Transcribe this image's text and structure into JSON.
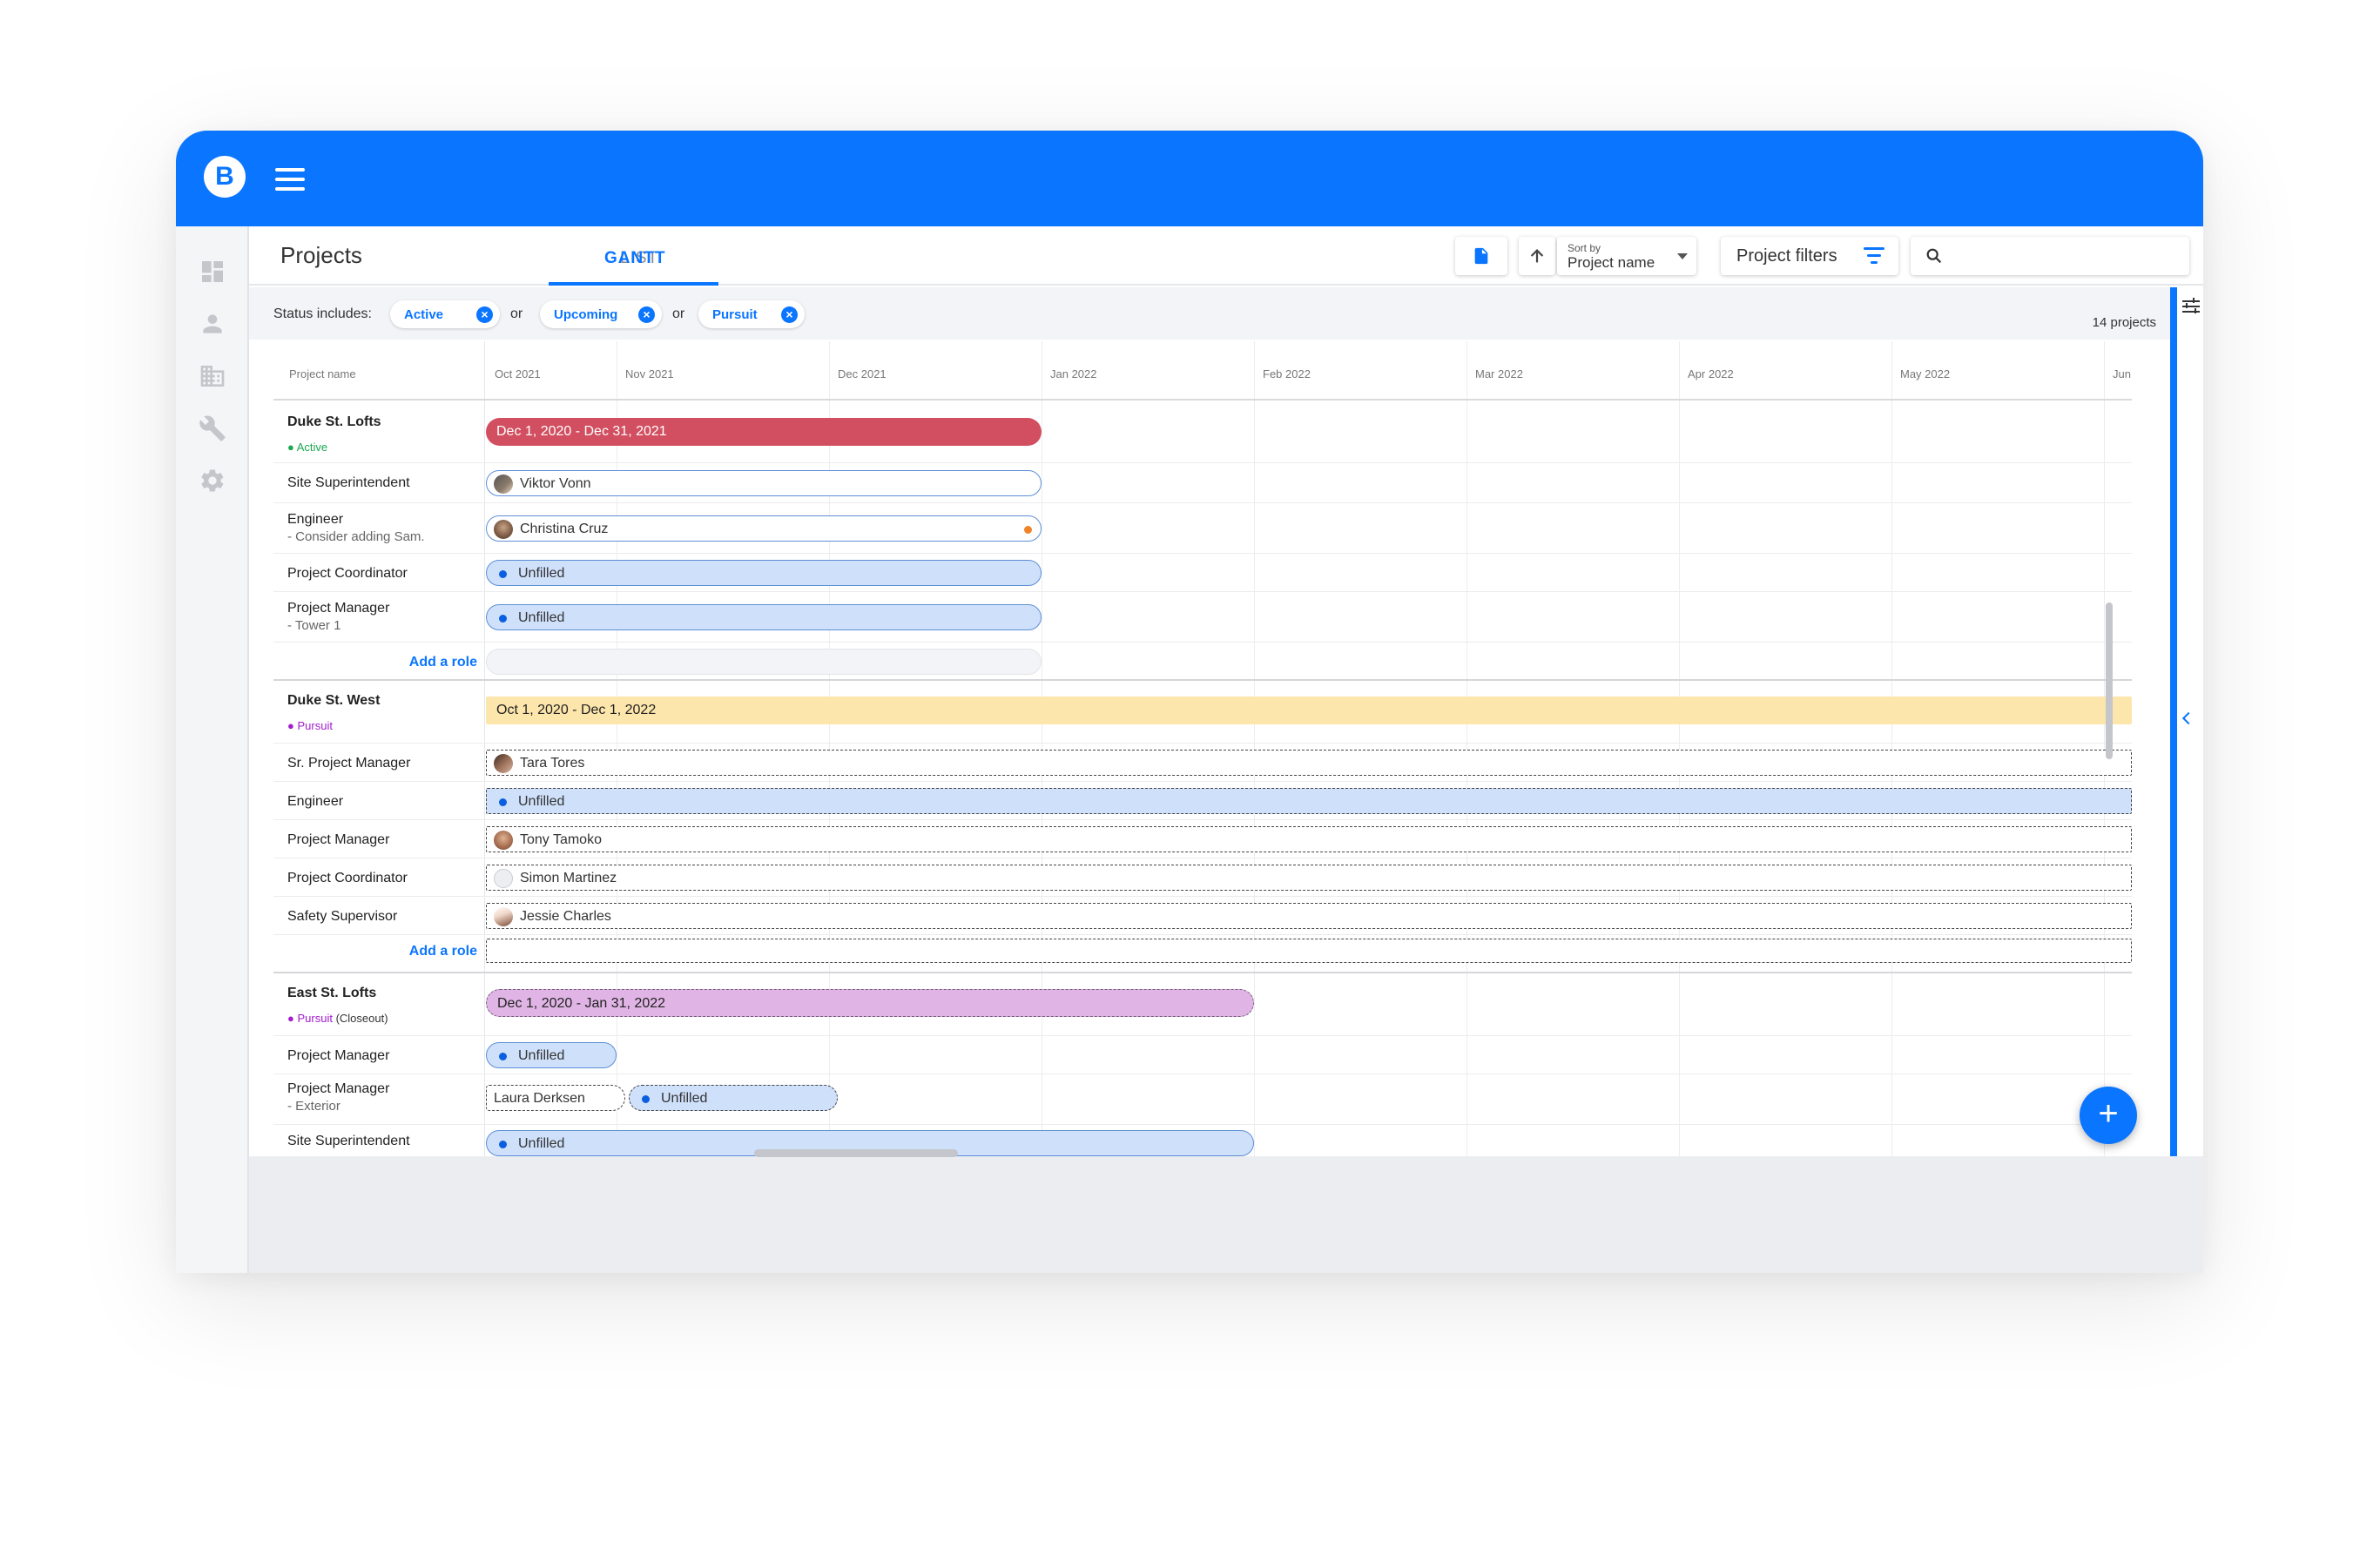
{
  "app": {
    "logo_letter": "B",
    "accent": "#0a75ff"
  },
  "header": {
    "title": "Projects",
    "tabs": [
      {
        "label": "LIST"
      },
      {
        "label": "GANTT"
      }
    ],
    "sort": {
      "small": "Sort by",
      "value": "Project name"
    },
    "filter_label": "Project filters",
    "search_placeholder": ""
  },
  "filters": {
    "label": "Status includes:",
    "chips": [
      "Active",
      "Upcoming",
      "Pursuit"
    ],
    "or": "or",
    "count": "14 projects"
  },
  "gantt": {
    "name_header": "Project name",
    "months": [
      "Oct 2021",
      "Nov 2021",
      "Dec 2021",
      "Jan 2022",
      "Feb 2022",
      "Mar 2022",
      "Apr 2022",
      "May 2022",
      "Jun"
    ],
    "add_role": "Add a role",
    "unfilled": "Unfilled",
    "projects": [
      {
        "name": "Duke St. Lofts",
        "status": "Active",
        "status_color": "#1aa84f",
        "dates": "Dec 1, 2020 - Dec 31, 2021",
        "roles": [
          {
            "title": "Site Superintendent",
            "sub": "",
            "person": "Viktor Vonn"
          },
          {
            "title": "Engineer",
            "sub": "- Consider adding Sam.",
            "person": "Christina Cruz"
          },
          {
            "title": "Project Coordinator",
            "sub": "",
            "person": ""
          },
          {
            "title": "Project Manager",
            "sub": "- Tower 1",
            "person": ""
          }
        ]
      },
      {
        "name": "Duke St. West",
        "status": "Pursuit",
        "status_color": "#a41ccf",
        "dates": "Oct 1, 2020 - Dec 1, 2022",
        "roles": [
          {
            "title": "Sr. Project Manager",
            "person": "Tara Tores"
          },
          {
            "title": "Engineer",
            "person": ""
          },
          {
            "title": "Project Manager",
            "person": "Tony Tamoko"
          },
          {
            "title": "Project Coordinator",
            "person": "Simon Martinez"
          },
          {
            "title": "Safety Supervisor",
            "person": "Jessie Charles"
          }
        ]
      },
      {
        "name": "East St. Lofts",
        "status": "Pursuit",
        "status_extra": "(Closeout)",
        "status_color": "#a41ccf",
        "dates": "Dec 1, 2020 - Jan 31, 2022",
        "roles": [
          {
            "title": "Project Manager",
            "sub": "",
            "person": ""
          },
          {
            "title": "Project Manager",
            "sub": "- Exterior",
            "person": "Laura Derksen"
          },
          {
            "title": "Site Superintendent",
            "sub": "",
            "person": ""
          }
        ]
      }
    ]
  },
  "fab_label": "+"
}
